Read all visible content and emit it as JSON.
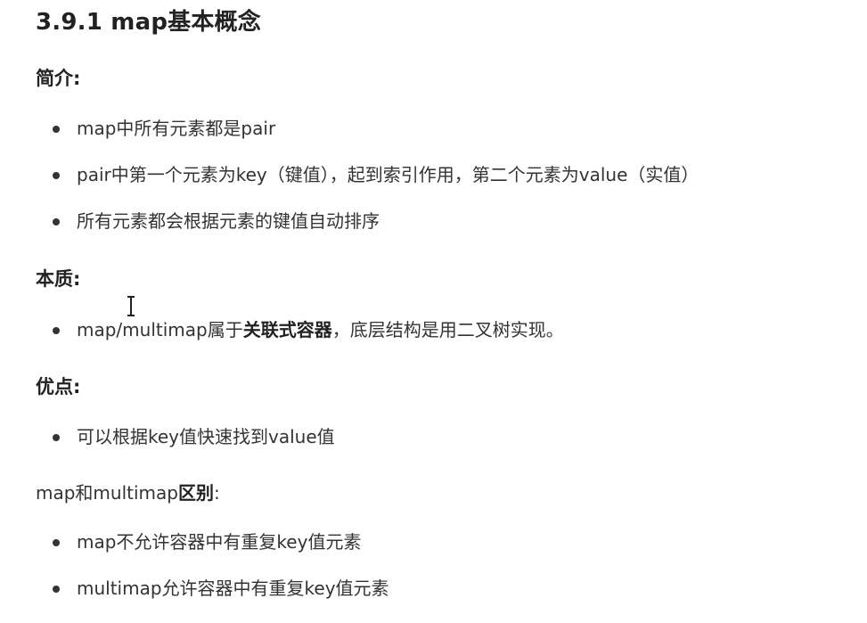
{
  "title": "3.9.1 map基本概念",
  "intro": {
    "heading": "简介:",
    "items": [
      "map中所有元素都是pair",
      "pair中第一个元素为key（键值），起到索引作用，第二个元素为value（实值）",
      "所有元素都会根据元素的键值自动排序"
    ]
  },
  "essence": {
    "heading": "本质:",
    "item_prefix": "map/multimap属于",
    "item_bold": "关联式容器",
    "item_suffix": "，底层结构是用二叉树实现。"
  },
  "advantage": {
    "heading": "优点:",
    "items": [
      "可以根据key值快速找到value值"
    ]
  },
  "difference": {
    "heading_prefix": "map和multimap",
    "heading_bold": "区别",
    "heading_suffix": ":",
    "items": [
      "map不允许容器中有重复key值元素",
      "multimap允许容器中有重复key值元素"
    ]
  },
  "icons": {
    "cursor": "text-cursor-icon"
  }
}
